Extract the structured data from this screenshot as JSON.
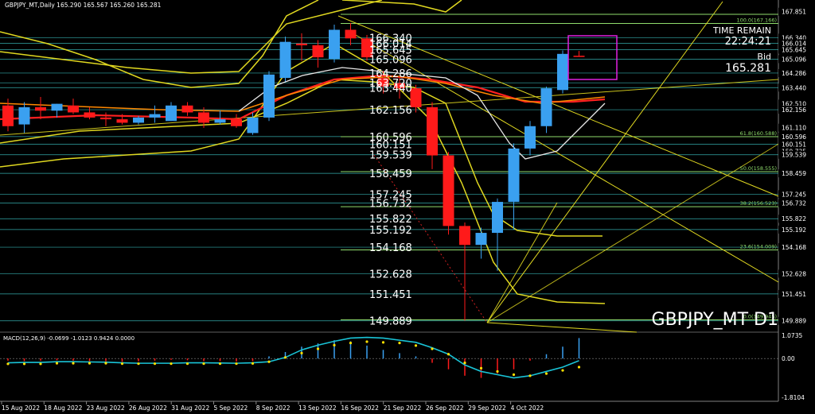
{
  "chart_data": {
    "type": "candlestick",
    "title": "GBPJPY_MT,Daily 165.290 165.567 165.260 165.281",
    "symbol_label": "GBPJPY_MT D1",
    "time_remain_label": "TIME REMAIN",
    "time_remain": "22:24:21",
    "bid_label": "Bid",
    "bid_value": "165.281",
    "price_axis_ticks": [
      "167.851",
      "166.340",
      "166.014",
      "165.645",
      "165.096",
      "164.286",
      "163.440",
      "162.510",
      "162.156",
      "161.110",
      "160.596",
      "160.151",
      "159.735",
      "159.539",
      "158.459",
      "157.245",
      "156.732",
      "155.822",
      "155.192",
      "154.168",
      "152.628",
      "151.451",
      "149.889"
    ],
    "levels": [
      166.34,
      166.014,
      165.645,
      165.096,
      164.286,
      163.72,
      163.44,
      162.156,
      160.596,
      160.151,
      159.539,
      158.459,
      157.245,
      156.732,
      155.822,
      155.192,
      154.168,
      152.628,
      151.451,
      149.889
    ],
    "level_labels": [
      "166.340",
      "166.014",
      "165.645",
      "165.096",
      "164.286",
      "163.720",
      "163.440",
      "162.156",
      "160.596",
      "160.151",
      "159.539",
      "158.459",
      "157.245",
      "156.732",
      "155.822",
      "155.192",
      "154.168",
      "152.628",
      "151.451",
      "149.889"
    ],
    "fib_levels": [
      {
        "label": "100.0(167.166)",
        "value": 167.166
      },
      {
        "label": "61.8(160.588)",
        "value": 160.588
      },
      {
        "label": "50.0(158.555)",
        "value": 158.555
      },
      {
        "label": "38.2(156.523)",
        "value": 156.523
      },
      {
        "label": "23.6(154.009)",
        "value": 154.009
      },
      {
        "label": "0.0(149.945)",
        "value": 149.945
      }
    ],
    "dates": [
      "15 Aug 2022",
      "18 Aug 2022",
      "23 Aug 2022",
      "26 Aug 2022",
      "31 Aug 2022",
      "5 Sep 2022",
      "8 Sep 2022",
      "13 Sep 2022",
      "16 Sep 2022",
      "21 Sep 2022",
      "26 Sep 2022",
      "29 Sep 2022",
      "4 Oct 2022"
    ],
    "ylim": [
      149.6,
      168.3
    ],
    "candles": [
      {
        "o": 162.4,
        "h": 162.8,
        "l": 160.9,
        "c": 161.2
      },
      {
        "o": 161.3,
        "h": 162.6,
        "l": 160.8,
        "c": 162.3
      },
      {
        "o": 162.3,
        "h": 162.9,
        "l": 161.6,
        "c": 162.1
      },
      {
        "o": 162.1,
        "h": 162.5,
        "l": 161.7,
        "c": 162.5
      },
      {
        "o": 162.4,
        "h": 162.8,
        "l": 161.9,
        "c": 162.0
      },
      {
        "o": 162.0,
        "h": 162.3,
        "l": 161.6,
        "c": 161.7
      },
      {
        "o": 161.7,
        "h": 162.0,
        "l": 161.2,
        "c": 161.6
      },
      {
        "o": 161.6,
        "h": 161.9,
        "l": 161.3,
        "c": 161.4
      },
      {
        "o": 161.4,
        "h": 161.8,
        "l": 161.3,
        "c": 161.7
      },
      {
        "o": 161.7,
        "h": 162.4,
        "l": 161.4,
        "c": 161.9
      },
      {
        "o": 161.5,
        "h": 162.6,
        "l": 161.5,
        "c": 162.4
      },
      {
        "o": 162.4,
        "h": 162.6,
        "l": 161.8,
        "c": 162.0
      },
      {
        "o": 162.0,
        "h": 162.3,
        "l": 161.1,
        "c": 161.4
      },
      {
        "o": 161.4,
        "h": 162.1,
        "l": 161.3,
        "c": 161.6
      },
      {
        "o": 161.6,
        "h": 161.9,
        "l": 161.1,
        "c": 161.2
      },
      {
        "o": 160.8,
        "h": 162.0,
        "l": 160.7,
        "c": 161.7
      },
      {
        "o": 161.7,
        "h": 164.4,
        "l": 161.5,
        "c": 164.2
      },
      {
        "o": 164.0,
        "h": 166.4,
        "l": 163.8,
        "c": 166.1
      },
      {
        "o": 166.0,
        "h": 166.6,
        "l": 165.0,
        "c": 165.9
      },
      {
        "o": 165.9,
        "h": 166.2,
        "l": 164.6,
        "c": 165.2
      },
      {
        "o": 165.1,
        "h": 167.1,
        "l": 164.9,
        "c": 166.8
      },
      {
        "o": 166.8,
        "h": 167.2,
        "l": 165.9,
        "c": 166.3
      },
      {
        "o": 166.3,
        "h": 166.5,
        "l": 165.0,
        "c": 165.2
      },
      {
        "o": 164.0,
        "h": 164.4,
        "l": 163.1,
        "c": 163.5
      },
      {
        "o": 163.7,
        "h": 164.1,
        "l": 162.8,
        "c": 163.4
      },
      {
        "o": 163.4,
        "h": 163.6,
        "l": 162.0,
        "c": 162.3
      },
      {
        "o": 162.3,
        "h": 162.6,
        "l": 158.7,
        "c": 159.5
      },
      {
        "o": 159.5,
        "h": 159.7,
        "l": 154.9,
        "c": 155.4
      },
      {
        "o": 155.4,
        "h": 155.6,
        "l": 149.9,
        "c": 154.3
      },
      {
        "o": 154.3,
        "h": 155.3,
        "l": 153.5,
        "c": 155.0
      },
      {
        "o": 155.0,
        "h": 157.0,
        "l": 152.8,
        "c": 156.8
      },
      {
        "o": 156.8,
        "h": 160.2,
        "l": 155.2,
        "c": 159.9
      },
      {
        "o": 159.9,
        "h": 161.5,
        "l": 159.5,
        "c": 161.2
      },
      {
        "o": 161.2,
        "h": 163.5,
        "l": 160.8,
        "c": 163.4
      },
      {
        "o": 163.3,
        "h": 165.6,
        "l": 163.1,
        "c": 165.4
      },
      {
        "o": 165.29,
        "h": 165.57,
        "l": 165.26,
        "c": 165.28
      }
    ],
    "macd": {
      "label": "MACD(12,26,9) -0.0699 -1.0123 0.9424 0.0000",
      "axis_ticks": [
        "1.0735",
        "0.00",
        "-1.8104"
      ],
      "ylim": [
        -1.95,
        1.15
      ],
      "histogram": [
        -0.1,
        -0.12,
        -0.1,
        -0.08,
        -0.1,
        -0.12,
        -0.13,
        -0.15,
        -0.13,
        -0.1,
        -0.06,
        -0.08,
        -0.12,
        -0.12,
        -0.14,
        -0.12,
        0.1,
        0.3,
        0.55,
        0.7,
        0.85,
        0.8,
        0.6,
        0.4,
        0.25,
        0.1,
        -0.2,
        -0.5,
        -0.8,
        -0.9,
        -0.7,
        -0.5,
        -0.1,
        0.2,
        0.55,
        0.95
      ],
      "signal": [
        -0.2,
        -0.18,
        -0.18,
        -0.15,
        -0.15,
        -0.16,
        -0.17,
        -0.2,
        -0.22,
        -0.22,
        -0.22,
        -0.2,
        -0.2,
        -0.21,
        -0.22,
        -0.2,
        -0.15,
        0.05,
        0.4,
        0.62,
        0.8,
        0.95,
        0.98,
        0.95,
        0.85,
        0.75,
        0.5,
        0.2,
        -0.3,
        -0.6,
        -0.75,
        -0.9,
        -0.8,
        -0.6,
        -0.4,
        -0.1
      ],
      "signal_dots": [
        -0.25,
        -0.25,
        -0.25,
        -0.22,
        -0.22,
        -0.22,
        -0.22,
        -0.24,
        -0.24,
        -0.24,
        -0.24,
        -0.24,
        -0.24,
        -0.24,
        -0.24,
        -0.23,
        -0.15,
        0.05,
        0.25,
        0.45,
        0.62,
        0.72,
        0.78,
        0.75,
        0.72,
        0.6,
        0.45,
        0.2,
        -0.2,
        -0.45,
        -0.6,
        -0.75,
        -0.8,
        -0.7,
        -0.55,
        -0.4
      ]
    },
    "colors": {
      "bull": "#3aa0f0",
      "bear": "#ff1a1a",
      "ma_red": "#ff2020",
      "ma_yellow": "#e0d820",
      "ma_white": "#e8e8e8",
      "level": "#3cc8c8",
      "fib": "#8fdc6c",
      "box": "#e020e0",
      "macd_line": "#19c3d6",
      "macd_dot": "#ffe000"
    },
    "grid": false
  }
}
